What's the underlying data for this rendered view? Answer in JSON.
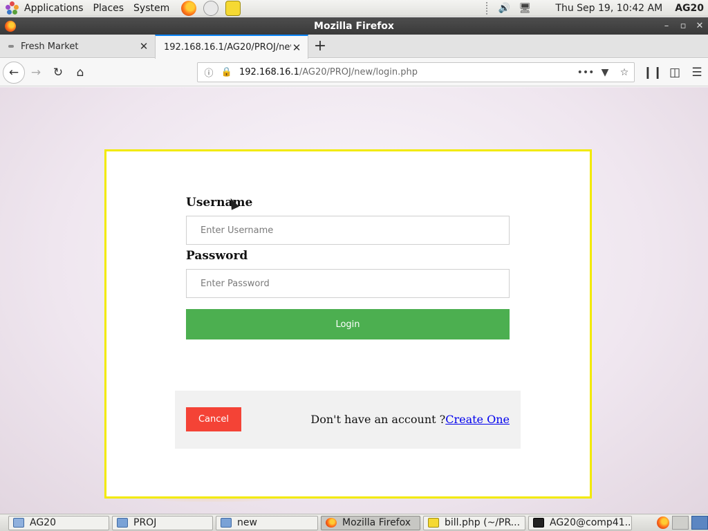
{
  "top_panel": {
    "menus": [
      "Applications",
      "Places",
      "System"
    ],
    "clock": "Thu Sep 19, 10:42 AM",
    "user": "AG20"
  },
  "window": {
    "title": "Mozilla Firefox"
  },
  "tabs": [
    {
      "label": "Fresh Market",
      "active": false
    },
    {
      "label": "192.168.16.1/AG20/PROJ/new",
      "active": true
    }
  ],
  "navbar": {
    "url_host": "192.168.16.1",
    "url_path": "/AG20/PROJ/new/login.php"
  },
  "login": {
    "username_label": "Username",
    "username_placeholder": "Enter Username",
    "password_label": "Password",
    "password_placeholder": "Enter Password",
    "login_button": "Login",
    "cancel_button": "Cancel",
    "signup_text": "Don't have an account ?",
    "signup_link": "Create One",
    "colors": {
      "login": "#4caf50",
      "cancel": "#f44336",
      "border": "#f2ea00"
    }
  },
  "taskbar": {
    "items": [
      {
        "label": "AG20",
        "icon": "home-folder-icon"
      },
      {
        "label": "PROJ",
        "icon": "folder-icon"
      },
      {
        "label": "new",
        "icon": "folder-icon"
      },
      {
        "label": "Mozilla Firefox",
        "icon": "firefox-icon"
      },
      {
        "label": "bill.php (~/PR...",
        "icon": "text-editor-icon"
      },
      {
        "label": "AG20@comp41...",
        "icon": "terminal-icon"
      }
    ]
  }
}
